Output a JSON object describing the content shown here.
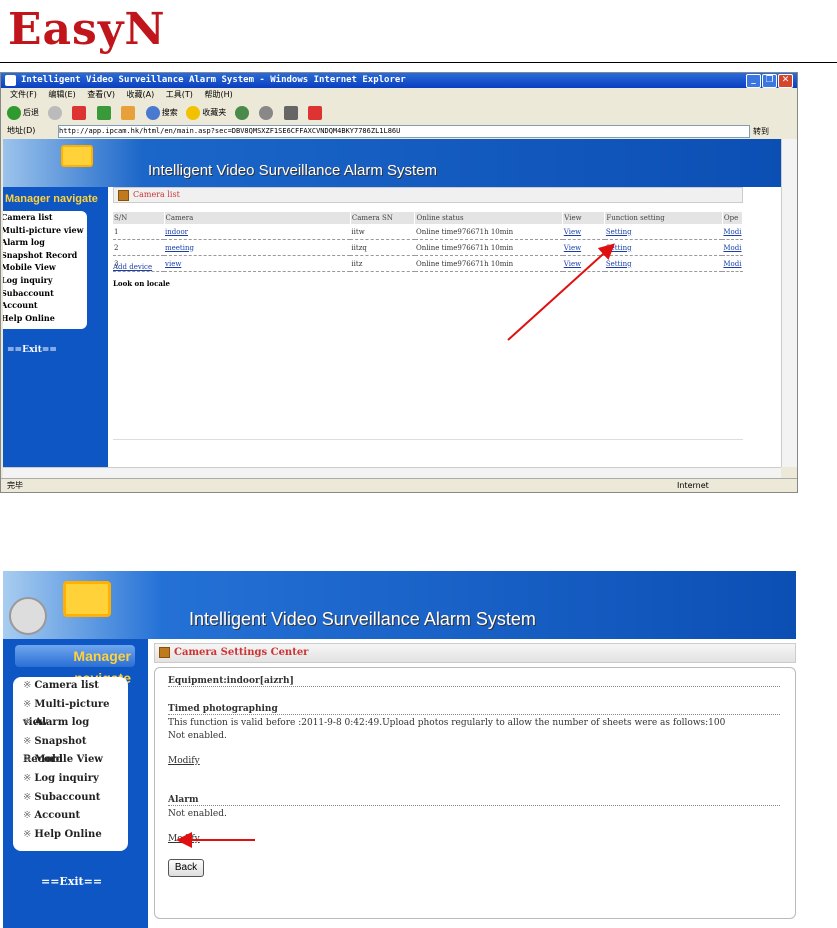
{
  "logo": "EasyN",
  "browser": {
    "title": "Intelligent Video Surveillance Alarm System - Windows Internet Explorer",
    "menu": [
      "文件(F)",
      "编辑(E)",
      "查看(V)",
      "收藏(A)",
      "工具(T)",
      "帮助(H)"
    ],
    "toolbar": {
      "back": "后退",
      "search": "搜索",
      "favorites": "收藏夹"
    },
    "address_label": "地址(D)",
    "url": "http://app.ipcam.hk/html/en/main.asp?sec=DBV8QMSXZF1SE6CFFAXCVNDQM4BKY7786ZL1L86U",
    "go": "转到",
    "status_left": "完毕",
    "status_right": "Internet"
  },
  "app1": {
    "banner_title": "Intelligent Video Surveillance Alarm System",
    "nav_header": "Manager navigate",
    "nav_items": [
      "Camera list",
      "Multi-picture view",
      "Alarm log",
      "Snapshot Record",
      "Mobile View",
      "Log inquiry",
      "Subaccount",
      "Account",
      "Help Online"
    ],
    "exit": "==Exit==",
    "section_title": "Camera list",
    "columns": [
      "S/N",
      "Camera",
      "Camera SN",
      "Online status",
      "View",
      "Function setting",
      "Ope"
    ],
    "rows": [
      {
        "sn": "1",
        "camera": "indoor",
        "camera_sn": "iitw",
        "status": "Online time976671h 10min",
        "view": "View",
        "setting": "Setting",
        "op": "Modi"
      },
      {
        "sn": "2",
        "camera": "meeting",
        "camera_sn": "iitzq",
        "status": "Online time976671h 10min",
        "view": "View",
        "setting": "Setting",
        "op": "Modi"
      },
      {
        "sn": "3",
        "camera": "view",
        "camera_sn": "iitz",
        "status": "Online time976671h 10min",
        "view": "View",
        "setting": "Setting",
        "op": "Modi"
      }
    ],
    "add_device": "Add device",
    "look_on_locale": "Look on locale"
  },
  "app2": {
    "banner_title": "Intelligent Video Surveillance Alarm System",
    "nav_header": "Manager navigate",
    "nav_items": [
      "Camera list",
      "Multi-picture view",
      "Alarm log",
      "Snapshot Record",
      "Mobile View",
      "Log inquiry",
      "Subaccount",
      "Account",
      "Help Online"
    ],
    "exit": "==Exit==",
    "section_title": "Camera Settings Center",
    "equipment": "Equipment:indoor[aizrh]",
    "timed_title": "Timed photographing",
    "timed_desc": "This function is valid before :2011-9-8 0:42:49.Upload photos regularly to allow the number of sheets were as follows:100",
    "timed_status": "Not enabled.",
    "modify1": "Modify",
    "alarm_title": "Alarm",
    "alarm_status": "Not enabled.",
    "modify2": "Modify",
    "back": "Back"
  },
  "colors": {
    "brand": "#c0161b",
    "nav_blue": "#0e56c3",
    "header_yellow": "#ffd23a",
    "arrow": "#e01010"
  }
}
